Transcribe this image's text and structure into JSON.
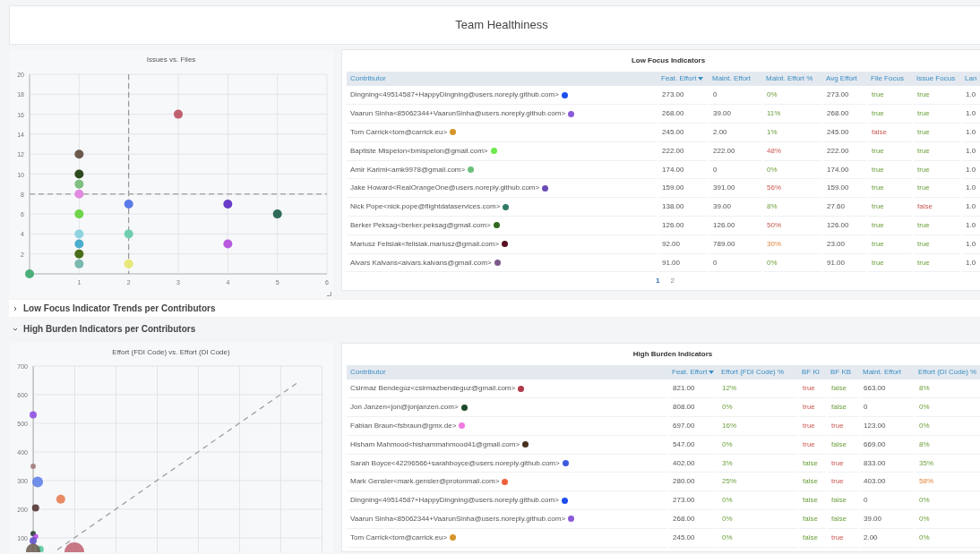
{
  "title": "Team Healthiness",
  "top": {
    "chart": {
      "chart_data": {
        "type": "scatter",
        "title": "Issues vs. Files",
        "xlim": [
          0,
          6
        ],
        "ylim": [
          0,
          20
        ],
        "xticks": [
          1,
          2,
          3,
          4,
          5,
          6
        ],
        "yticks": [
          2,
          4,
          6,
          8,
          10,
          12,
          14,
          16,
          18,
          20
        ],
        "grid": true,
        "series": [
          {
            "color": "#4caf7a",
            "x": [
              0
            ],
            "values": [
              0
            ]
          },
          {
            "color": "#6b5a4e",
            "x": [
              1
            ],
            "values": [
              12
            ]
          },
          {
            "color": "#2d4a1e",
            "x": [
              1
            ],
            "values": [
              10
            ]
          },
          {
            "color": "#7fbf7f",
            "x": [
              1
            ],
            "values": [
              9
            ]
          },
          {
            "color": "#e08ae0",
            "x": [
              1
            ],
            "values": [
              8
            ]
          },
          {
            "color": "#6fd44a",
            "x": [
              1
            ],
            "values": [
              6
            ]
          },
          {
            "color": "#8fd3e0",
            "x": [
              1
            ],
            "values": [
              4
            ]
          },
          {
            "color": "#4aaecc",
            "x": [
              1
            ],
            "values": [
              3
            ]
          },
          {
            "color": "#4a6e1a",
            "x": [
              1
            ],
            "values": [
              2
            ]
          },
          {
            "color": "#7ab8b0",
            "x": [
              1
            ],
            "values": [
              1
            ]
          },
          {
            "color": "#5b7be8",
            "x": [
              2
            ],
            "values": [
              7
            ]
          },
          {
            "color": "#6fcfb0",
            "x": [
              2
            ],
            "values": [
              4
            ]
          },
          {
            "color": "#e8e87a",
            "x": [
              2
            ],
            "values": [
              1
            ]
          },
          {
            "color": "#c0606e",
            "x": [
              3
            ],
            "values": [
              16
            ]
          },
          {
            "color": "#6a3cc8",
            "x": [
              4
            ],
            "values": [
              7
            ]
          },
          {
            "color": "#b85ae0",
            "x": [
              4
            ],
            "values": [
              3
            ]
          },
          {
            "color": "#2f6b5a",
            "x": [
              5
            ],
            "values": [
              6
            ]
          }
        ],
        "ref_lines": [
          {
            "axis": "x",
            "value": 2
          },
          {
            "axis": "y",
            "value": 8
          }
        ]
      }
    },
    "table": {
      "title": "Low Focus Indicators",
      "columns": [
        {
          "label": "Contributor",
          "sorted": false
        },
        {
          "label": "Feat. Effort",
          "sorted": true
        },
        {
          "label": "Maint. Effort",
          "sorted": false
        },
        {
          "label": "Maint. Effort %",
          "sorted": false
        },
        {
          "label": "Avg Effort",
          "sorted": false
        },
        {
          "label": "File Focus",
          "sorted": false
        },
        {
          "label": "Issue Focus",
          "sorted": false
        },
        {
          "label": "Lan",
          "sorted": false
        }
      ],
      "rows": [
        {
          "cells": [
            {
              "text": "Dingning<49514587+HappyDingning@users.noreply.github.com>",
              "kind": "contributor",
              "color": "#1d4ef0"
            },
            {
              "text": "273.00",
              "kind": "plain"
            },
            {
              "text": "0",
              "kind": "plain"
            },
            {
              "text": "0%",
              "kind": "ok"
            },
            {
              "text": "273.00",
              "kind": "plain"
            },
            {
              "text": "true",
              "kind": "ok"
            },
            {
              "text": "true",
              "kind": "ok"
            },
            {
              "text": "1.0",
              "kind": "plain"
            }
          ]
        },
        {
          "cells": [
            {
              "text": "Vaarun Sinha<85062344+VaarunSinha@users.noreply.github.com>",
              "kind": "contributor",
              "color": "#8a5ad8"
            },
            {
              "text": "268.00",
              "kind": "plain"
            },
            {
              "text": "39.00",
              "kind": "plain"
            },
            {
              "text": "11%",
              "kind": "ok"
            },
            {
              "text": "268.00",
              "kind": "plain"
            },
            {
              "text": "true",
              "kind": "ok"
            },
            {
              "text": "true",
              "kind": "ok"
            },
            {
              "text": "1.0",
              "kind": "plain"
            }
          ]
        },
        {
          "cells": [
            {
              "text": "Tom Carrick<tom@carrick.eu>",
              "kind": "contributor",
              "color": "#d4962a"
            },
            {
              "text": "245.00",
              "kind": "plain"
            },
            {
              "text": "2.00",
              "kind": "plain"
            },
            {
              "text": "1%",
              "kind": "ok"
            },
            {
              "text": "245.00",
              "kind": "plain"
            },
            {
              "text": "false",
              "kind": "alert"
            },
            {
              "text": "true",
              "kind": "ok"
            },
            {
              "text": "1.0",
              "kind": "plain"
            }
          ]
        },
        {
          "cells": [
            {
              "text": "Baptiste Mispelon<bmispelon@gmail.com>",
              "kind": "contributor",
              "color": "#6ee84a"
            },
            {
              "text": "222.00",
              "kind": "plain"
            },
            {
              "text": "222.00",
              "kind": "plain"
            },
            {
              "text": "48%",
              "kind": "alert"
            },
            {
              "text": "222.00",
              "kind": "plain"
            },
            {
              "text": "true",
              "kind": "ok"
            },
            {
              "text": "true",
              "kind": "ok"
            },
            {
              "text": "1.0",
              "kind": "plain"
            }
          ]
        },
        {
          "cells": [
            {
              "text": "Amir Karimi<amk9978@gmail.com>",
              "kind": "contributor",
              "color": "#6cc07a"
            },
            {
              "text": "174.00",
              "kind": "plain"
            },
            {
              "text": "0",
              "kind": "plain"
            },
            {
              "text": "0%",
              "kind": "ok"
            },
            {
              "text": "174.00",
              "kind": "plain"
            },
            {
              "text": "true",
              "kind": "ok"
            },
            {
              "text": "true",
              "kind": "ok"
            },
            {
              "text": "1.0",
              "kind": "plain"
            }
          ]
        },
        {
          "cells": [
            {
              "text": "Jake Howard<RealOrangeOne@users.noreply.github.com>",
              "kind": "contributor",
              "color": "#6a4ab8"
            },
            {
              "text": "159.00",
              "kind": "plain"
            },
            {
              "text": "391.00",
              "kind": "plain"
            },
            {
              "text": "56%",
              "kind": "alert"
            },
            {
              "text": "159.00",
              "kind": "plain"
            },
            {
              "text": "true",
              "kind": "ok"
            },
            {
              "text": "true",
              "kind": "ok"
            },
            {
              "text": "1.0",
              "kind": "plain"
            }
          ]
        },
        {
          "cells": [
            {
              "text": "Nick Pope<nick.pope@flightdataservices.com>",
              "kind": "contributor",
              "color": "#2f7a66"
            },
            {
              "text": "138.00",
              "kind": "plain"
            },
            {
              "text": "39.00",
              "kind": "plain"
            },
            {
              "text": "8%",
              "kind": "ok"
            },
            {
              "text": "27.60",
              "kind": "plain"
            },
            {
              "text": "true",
              "kind": "ok"
            },
            {
              "text": "false",
              "kind": "alert"
            },
            {
              "text": "1.0",
              "kind": "plain"
            }
          ]
        },
        {
          "cells": [
            {
              "text": "Berker Peksag<berker.peksag@gmail.com>",
              "kind": "contributor",
              "color": "#2f6a1e"
            },
            {
              "text": "126.00",
              "kind": "plain"
            },
            {
              "text": "126.00",
              "kind": "plain"
            },
            {
              "text": "50%",
              "kind": "alert"
            },
            {
              "text": "126.00",
              "kind": "plain"
            },
            {
              "text": "true",
              "kind": "ok"
            },
            {
              "text": "true",
              "kind": "ok"
            },
            {
              "text": "1.0",
              "kind": "plain"
            }
          ]
        },
        {
          "cells": [
            {
              "text": "Mariusz Felisiak<felisiak.mariusz@gmail.com>",
              "kind": "contributor",
              "color": "#5a1020"
            },
            {
              "text": "92.00",
              "kind": "plain"
            },
            {
              "text": "789.00",
              "kind": "plain"
            },
            {
              "text": "30%",
              "kind": "warning"
            },
            {
              "text": "23.00",
              "kind": "plain"
            },
            {
              "text": "true",
              "kind": "ok"
            },
            {
              "text": "true",
              "kind": "ok"
            },
            {
              "text": "1.0",
              "kind": "plain"
            }
          ]
        },
        {
          "cells": [
            {
              "text": "Aivars Kalvans<aivars.kalvans@gmail.com>",
              "kind": "contributor",
              "color": "#7a5a8a"
            },
            {
              "text": "91.00",
              "kind": "plain"
            },
            {
              "text": "0",
              "kind": "plain"
            },
            {
              "text": "0%",
              "kind": "ok"
            },
            {
              "text": "91.00",
              "kind": "plain"
            },
            {
              "text": "true",
              "kind": "ok"
            },
            {
              "text": "true",
              "kind": "ok"
            },
            {
              "text": "1.0",
              "kind": "plain"
            }
          ]
        }
      ],
      "pages": [
        {
          "label": "1",
          "selected": true
        },
        {
          "label": "2",
          "selected": false
        }
      ]
    }
  },
  "sections": [
    {
      "title": "Low Focus Indicator Trends per Contributors",
      "expanded": false
    },
    {
      "title": "High Burden Indicators per Contributors",
      "expanded": true,
      "chart": {
        "title": "Effort (FDI Code) vs. Effort (DI Code)",
        "y_labels": [
          "700",
          "600",
          "500",
          "400",
          "300",
          "200",
          "100"
        ]
      },
      "table": {
        "title": "High Burden Indicators",
        "columns": [
          {
            "label": "Contributor",
            "sorted": false
          },
          {
            "label": "Feat. Effort",
            "sorted": true
          },
          {
            "label": "Effort (FDI Code) %",
            "sorted": false
          },
          {
            "label": "BF KI",
            "sorted": false
          },
          {
            "label": "BF KB",
            "sorted": false
          },
          {
            "label": "Maint. Effort",
            "sorted": false
          },
          {
            "label": "Effort (DI Code) %",
            "sorted": false
          }
        ],
        "rows": [
          {
            "cells": [
              {
                "text": "Csirmaz Bendegúz<csirmazbendeguz@gmail.com>",
                "kind": "contributor",
                "color": "#b03a4a"
              },
              {
                "text": "821.00",
                "kind": "plain"
              },
              {
                "text": "12%",
                "kind": "ok"
              },
              {
                "text": "true",
                "kind": "alert"
              },
              {
                "text": "false",
                "kind": "ok"
              },
              {
                "text": "663.00",
                "kind": "plain"
              },
              {
                "text": "8%",
                "kind": "ok"
              }
            ]
          },
          {
            "cells": [
              {
                "text": "Jon Janzen<jon@jonjanzen.com>",
                "kind": "contributor",
                "color": "#1f4a2a"
              },
              {
                "text": "808.00",
                "kind": "plain"
              },
              {
                "text": "0%",
                "kind": "ok"
              },
              {
                "text": "true",
                "kind": "alert"
              },
              {
                "text": "false",
                "kind": "ok"
              },
              {
                "text": "0",
                "kind": "plain"
              },
              {
                "text": "0%",
                "kind": "ok"
              }
            ]
          },
          {
            "cells": [
              {
                "text": "Fabian Braun<fsbraun@gmx.de>",
                "kind": "contributor",
                "color": "#f07ae0"
              },
              {
                "text": "697.00",
                "kind": "plain"
              },
              {
                "text": "16%",
                "kind": "ok"
              },
              {
                "text": "true",
                "kind": "alert"
              },
              {
                "text": "true",
                "kind": "alert"
              },
              {
                "text": "123.00",
                "kind": "plain"
              },
              {
                "text": "0%",
                "kind": "ok"
              }
            ]
          },
          {
            "cells": [
              {
                "text": "Hisham Mahmood<hishammahmood41@gmail.com>",
                "kind": "contributor",
                "color": "#4a3020"
              },
              {
                "text": "547.00",
                "kind": "plain"
              },
              {
                "text": "0%",
                "kind": "ok"
              },
              {
                "text": "true",
                "kind": "alert"
              },
              {
                "text": "false",
                "kind": "ok"
              },
              {
                "text": "669.00",
                "kind": "plain"
              },
              {
                "text": "8%",
                "kind": "ok"
              }
            ]
          },
          {
            "cells": [
              {
                "text": "Sarah Boyce<42296566+sarahboyce@users.noreply.github.com>",
                "kind": "contributor",
                "color": "#3a5ae0"
              },
              {
                "text": "402.00",
                "kind": "plain"
              },
              {
                "text": "3%",
                "kind": "ok"
              },
              {
                "text": "false",
                "kind": "ok"
              },
              {
                "text": "true",
                "kind": "alert"
              },
              {
                "text": "833.00",
                "kind": "plain"
              },
              {
                "text": "35%",
                "kind": "ok"
              }
            ]
          },
          {
            "cells": [
              {
                "text": "Mark Gensler<mark.gensler@protonmail.com>",
                "kind": "contributor",
                "color": "#f0603a"
              },
              {
                "text": "280.00",
                "kind": "plain"
              },
              {
                "text": "25%",
                "kind": "ok"
              },
              {
                "text": "false",
                "kind": "ok"
              },
              {
                "text": "true",
                "kind": "alert"
              },
              {
                "text": "403.00",
                "kind": "plain"
              },
              {
                "text": "58%",
                "kind": "warning"
              }
            ]
          },
          {
            "cells": [
              {
                "text": "Dingning<49514587+HappyDingning@users.noreply.github.com>",
                "kind": "contributor",
                "color": "#1d4ef0"
              },
              {
                "text": "273.00",
                "kind": "plain"
              },
              {
                "text": "0%",
                "kind": "ok"
              },
              {
                "text": "false",
                "kind": "ok"
              },
              {
                "text": "false",
                "kind": "ok"
              },
              {
                "text": "0",
                "kind": "plain"
              },
              {
                "text": "0%",
                "kind": "ok"
              }
            ]
          },
          {
            "cells": [
              {
                "text": "Vaarun Sinha<85062344+VaarunSinha@users.noreply.github.com>",
                "kind": "contributor",
                "color": "#8a5ad8"
              },
              {
                "text": "268.00",
                "kind": "plain"
              },
              {
                "text": "0%",
                "kind": "ok"
              },
              {
                "text": "false",
                "kind": "ok"
              },
              {
                "text": "false",
                "kind": "ok"
              },
              {
                "text": "39.00",
                "kind": "plain"
              },
              {
                "text": "0%",
                "kind": "ok"
              }
            ]
          },
          {
            "cells": [
              {
                "text": "Tom Carrick<tom@carrick.eu>",
                "kind": "contributor",
                "color": "#d4962a"
              },
              {
                "text": "245.00",
                "kind": "plain"
              },
              {
                "text": "0%",
                "kind": "ok"
              },
              {
                "text": "false",
                "kind": "ok"
              },
              {
                "text": "true",
                "kind": "alert"
              },
              {
                "text": "2.00",
                "kind": "plain"
              },
              {
                "text": "0%",
                "kind": "ok"
              }
            ]
          }
        ]
      }
    }
  ]
}
